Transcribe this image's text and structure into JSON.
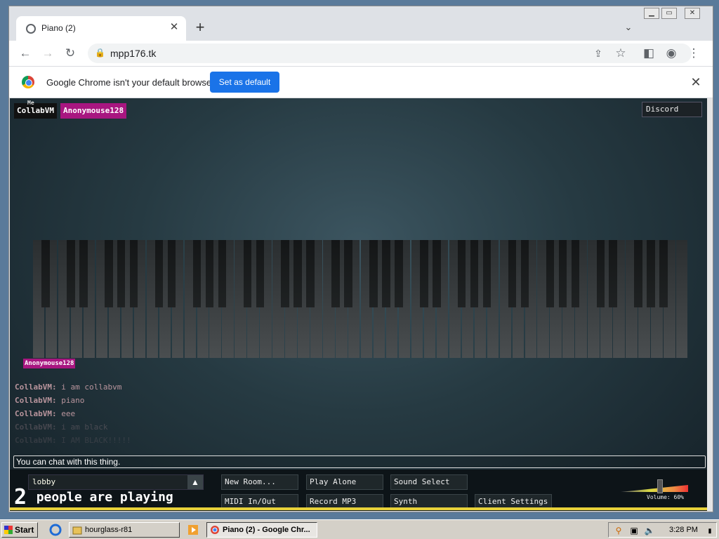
{
  "browser": {
    "tab_title": "Piano (2)",
    "url": "mpp176.tk",
    "infobar_message": "Google Chrome isn't your default browser",
    "infobar_button": "Set as default"
  },
  "page": {
    "users": [
      {
        "name": "CollabVM",
        "badge": "Me",
        "color": "#111111"
      },
      {
        "name": "Anonymouse128",
        "color": "#a81680"
      }
    ],
    "discord_label": "Discord",
    "cursor_tag": "Anonymouse128",
    "chat": [
      {
        "name": "CollabVM:",
        "message": "i am collabvm",
        "opacity": 0.9
      },
      {
        "name": "CollabVM:",
        "message": "piano",
        "opacity": 0.9
      },
      {
        "name": "CollabVM:",
        "message": "eee",
        "opacity": 0.9
      },
      {
        "name": "CollabVM:",
        "message": "i am black",
        "opacity": 0.25
      },
      {
        "name": "CollabVM:",
        "message": "I AM BLACK!!!!!",
        "opacity": 0.15
      }
    ],
    "chat_placeholder": "You can chat with this thing.",
    "room": "lobby",
    "people_count": "2",
    "people_label": "people are playing",
    "buttons": {
      "new_room": "New Room...",
      "play_alone": "Play Alone",
      "sound_select": "Sound Select",
      "midi": "MIDI In/Out",
      "record": "Record MP3",
      "synth": "Synth",
      "client_settings": "Client Settings"
    },
    "volume_label": "Volume: 60%",
    "volume_level": 0.6
  },
  "taskbar": {
    "start": "Start",
    "tasks": [
      "hourglass-r81",
      "Piano (2) - Google Chr..."
    ],
    "clock": "3:28 PM"
  },
  "colors": {
    "accent_blue": "#1a73e8",
    "user_pink": "#a81680",
    "chat_text": "#c9a0a8"
  }
}
